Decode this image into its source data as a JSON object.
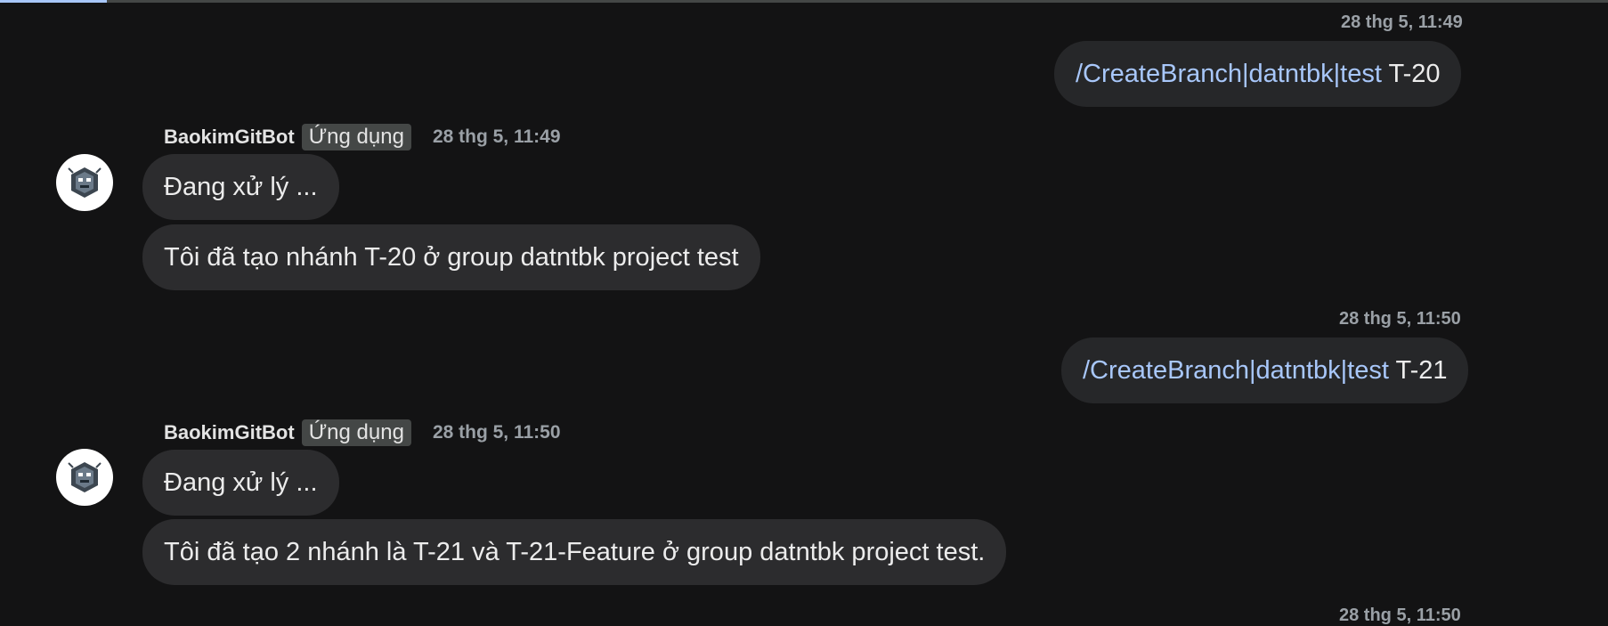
{
  "messages": [
    {
      "type": "outgoing",
      "time": "28 thg 5, 11:49",
      "command": "/CreateBranch|datntbk|test",
      "arg": " T-20"
    },
    {
      "type": "incoming",
      "sender": "BaokimGitBot",
      "badge": "Ứng dụng",
      "time": "28 thg 5, 11:49",
      "lines": [
        "Đang xử lý ...",
        "Tôi đã tạo nhánh T-20 ở group datntbk project test"
      ]
    },
    {
      "type": "outgoing",
      "time": "28 thg 5, 11:50",
      "command": "/CreateBranch|datntbk|test",
      "arg": " T-21"
    },
    {
      "type": "incoming",
      "sender": "BaokimGitBot",
      "badge": "Ứng dụng",
      "time": "28 thg 5, 11:50",
      "lines": [
        "Đang xử lý ...",
        "Tôi đã tạo 2 nhánh là T-21 và T-21-Feature ở group datntbk project test."
      ]
    },
    {
      "type": "outgoing",
      "time": "28 thg 5, 11:50"
    }
  ],
  "avatar_icon": "bot-robot-icon",
  "colors": {
    "background": "#131314",
    "bubble": "#2c2c2e",
    "command_link": "#a8c7fa",
    "timestamp": "#9aa0a6"
  }
}
